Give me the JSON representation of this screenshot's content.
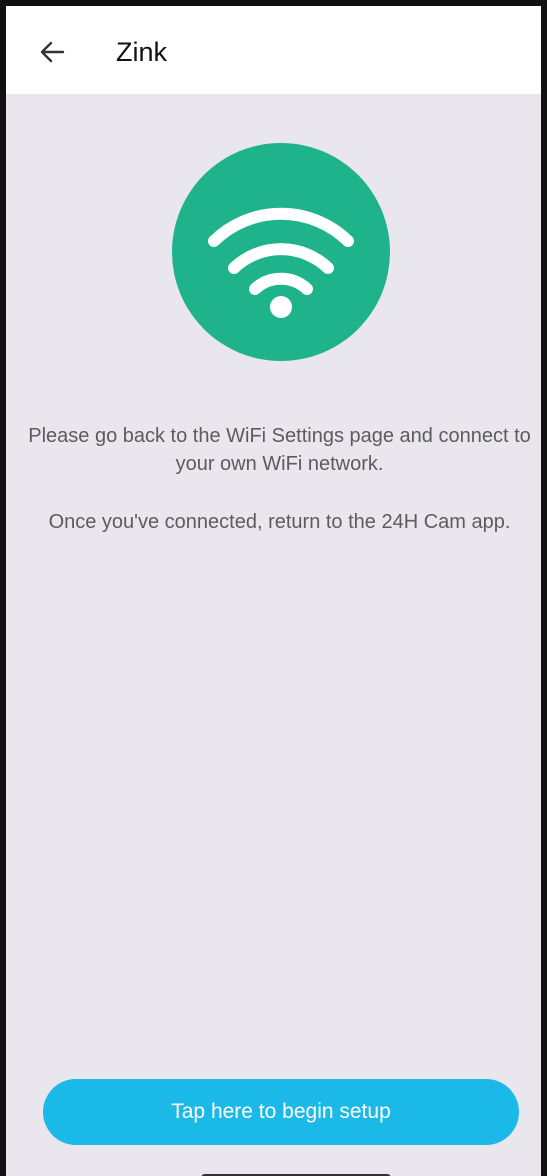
{
  "header": {
    "back_icon": "arrow-left-icon",
    "title": "Zink"
  },
  "hero": {
    "icon": "wifi-icon",
    "circle_color": "#1eb38a"
  },
  "instructions": {
    "line_1": "Please go back to the WiFi Settings page and connect to your own WiFi network.",
    "line_2": "Once you've connected, return to the 24H Cam app."
  },
  "footer": {
    "button_label": "Tap here to begin setup",
    "button_color": "#1bb9e7"
  }
}
